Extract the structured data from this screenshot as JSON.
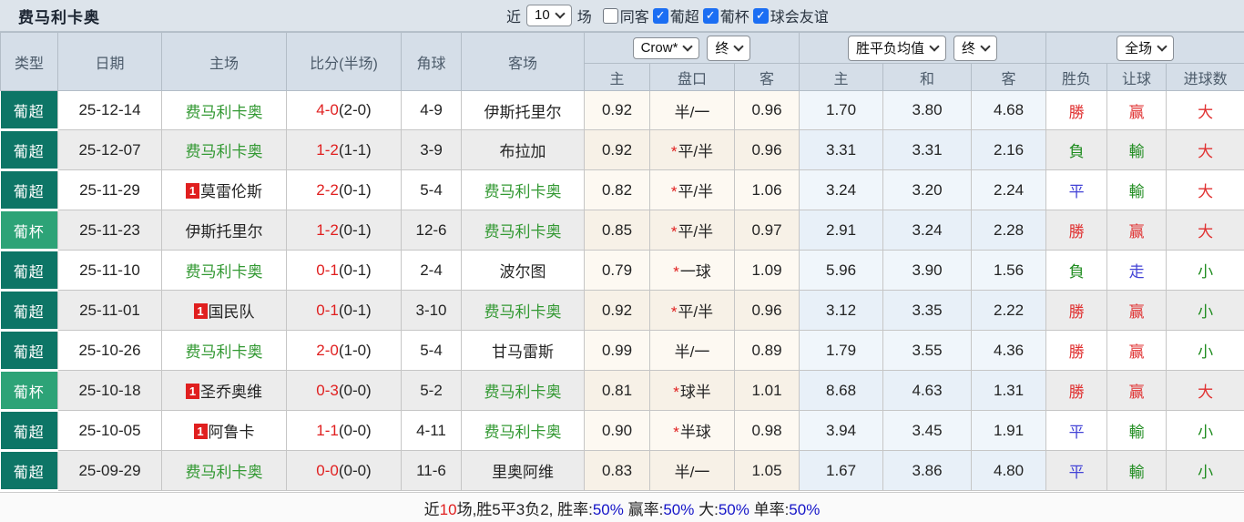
{
  "title": "费马利卡奥",
  "filters": {
    "recent_label": "近",
    "recent_value": "10",
    "recent_suffix": "场",
    "checkboxes": [
      {
        "label": "同客",
        "checked": false
      },
      {
        "label": "葡超",
        "checked": true
      },
      {
        "label": "葡杯",
        "checked": true
      },
      {
        "label": "球会友谊",
        "checked": true
      }
    ]
  },
  "table": {
    "columns": [
      "类型",
      "日期",
      "主场",
      "比分(半场)",
      "角球",
      "客场"
    ],
    "groups": [
      {
        "selects": [
          "Crow*",
          "终"
        ],
        "sub": [
          "主",
          "盘口",
          "客"
        ]
      },
      {
        "selects": [
          "胜平负均值",
          "终"
        ],
        "sub": [
          "主",
          "和",
          "客"
        ]
      },
      {
        "selects": [
          "全场"
        ],
        "sub": [
          "胜负",
          "让球",
          "进球数"
        ]
      }
    ],
    "rows": [
      {
        "league": "葡超",
        "date": "25-12-14",
        "home": {
          "name": "费马利卡奥",
          "self": true,
          "badge": null
        },
        "score": {
          "full": "4-0",
          "half": "(2-0)"
        },
        "corner": "4-9",
        "away": {
          "name": "伊斯托里尔",
          "self": false,
          "badge": null
        },
        "odds": [
          "0.92",
          "半/一",
          "0.96"
        ],
        "avg": [
          "1.70",
          "3.80",
          "4.68"
        ],
        "results": [
          {
            "t": "勝",
            "c": "red"
          },
          {
            "t": "赢",
            "c": "red"
          },
          {
            "t": "大",
            "c": "red"
          }
        ]
      },
      {
        "league": "葡超",
        "date": "25-12-07",
        "home": {
          "name": "费马利卡奥",
          "self": true,
          "badge": null
        },
        "score": {
          "full": "1-2",
          "half": "(1-1)"
        },
        "corner": "3-9",
        "away": {
          "name": "布拉加",
          "self": false,
          "badge": null
        },
        "odds": [
          "0.92",
          "*平/半",
          "0.96"
        ],
        "avg": [
          "3.31",
          "3.31",
          "2.16"
        ],
        "results": [
          {
            "t": "負",
            "c": "green"
          },
          {
            "t": "輸",
            "c": "green"
          },
          {
            "t": "大",
            "c": "red"
          }
        ]
      },
      {
        "league": "葡超",
        "date": "25-11-29",
        "home": {
          "name": "莫雷伦斯",
          "self": false,
          "badge": "1"
        },
        "score": {
          "full": "2-2",
          "half": "(0-1)"
        },
        "corner": "5-4",
        "away": {
          "name": "费马利卡奥",
          "self": true,
          "badge": null
        },
        "odds": [
          "0.82",
          "*平/半",
          "1.06"
        ],
        "avg": [
          "3.24",
          "3.20",
          "2.24"
        ],
        "results": [
          {
            "t": "平",
            "c": "blue"
          },
          {
            "t": "輸",
            "c": "green"
          },
          {
            "t": "大",
            "c": "red"
          }
        ]
      },
      {
        "league": "葡杯",
        "date": "25-11-23",
        "home": {
          "name": "伊斯托里尔",
          "self": false,
          "badge": null
        },
        "score": {
          "full": "1-2",
          "half": "(0-1)"
        },
        "corner": "12-6",
        "away": {
          "name": "费马利卡奥",
          "self": true,
          "badge": null
        },
        "odds": [
          "0.85",
          "*平/半",
          "0.97"
        ],
        "avg": [
          "2.91",
          "3.24",
          "2.28"
        ],
        "results": [
          {
            "t": "勝",
            "c": "red"
          },
          {
            "t": "赢",
            "c": "red"
          },
          {
            "t": "大",
            "c": "red"
          }
        ]
      },
      {
        "league": "葡超",
        "date": "25-11-10",
        "home": {
          "name": "费马利卡奥",
          "self": true,
          "badge": null
        },
        "score": {
          "full": "0-1",
          "half": "(0-1)"
        },
        "corner": "2-4",
        "away": {
          "name": "波尔图",
          "self": false,
          "badge": null
        },
        "odds": [
          "0.79",
          "*一球",
          "1.09"
        ],
        "avg": [
          "5.96",
          "3.90",
          "1.56"
        ],
        "results": [
          {
            "t": "負",
            "c": "green"
          },
          {
            "t": "走",
            "c": "blue"
          },
          {
            "t": "小",
            "c": "green"
          }
        ]
      },
      {
        "league": "葡超",
        "date": "25-11-01",
        "home": {
          "name": "国民队",
          "self": false,
          "badge": "1"
        },
        "score": {
          "full": "0-1",
          "half": "(0-1)"
        },
        "corner": "3-10",
        "away": {
          "name": "费马利卡奥",
          "self": true,
          "badge": null
        },
        "odds": [
          "0.92",
          "*平/半",
          "0.96"
        ],
        "avg": [
          "3.12",
          "3.35",
          "2.22"
        ],
        "results": [
          {
            "t": "勝",
            "c": "red"
          },
          {
            "t": "赢",
            "c": "red"
          },
          {
            "t": "小",
            "c": "green"
          }
        ]
      },
      {
        "league": "葡超",
        "date": "25-10-26",
        "home": {
          "name": "费马利卡奥",
          "self": true,
          "badge": null
        },
        "score": {
          "full": "2-0",
          "half": "(1-0)"
        },
        "corner": "5-4",
        "away": {
          "name": "甘马雷斯",
          "self": false,
          "badge": null
        },
        "odds": [
          "0.99",
          "半/一",
          "0.89"
        ],
        "avg": [
          "1.79",
          "3.55",
          "4.36"
        ],
        "results": [
          {
            "t": "勝",
            "c": "red"
          },
          {
            "t": "赢",
            "c": "red"
          },
          {
            "t": "小",
            "c": "green"
          }
        ]
      },
      {
        "league": "葡杯",
        "date": "25-10-18",
        "home": {
          "name": "圣乔奥维",
          "self": false,
          "badge": "1"
        },
        "score": {
          "full": "0-3",
          "half": "(0-0)"
        },
        "corner": "5-2",
        "away": {
          "name": "费马利卡奥",
          "self": true,
          "badge": null
        },
        "odds": [
          "0.81",
          "*球半",
          "1.01"
        ],
        "avg": [
          "8.68",
          "4.63",
          "1.31"
        ],
        "results": [
          {
            "t": "勝",
            "c": "red"
          },
          {
            "t": "赢",
            "c": "red"
          },
          {
            "t": "大",
            "c": "red"
          }
        ]
      },
      {
        "league": "葡超",
        "date": "25-10-05",
        "home": {
          "name": "阿鲁卡",
          "self": false,
          "badge": "1"
        },
        "score": {
          "full": "1-1",
          "half": "(0-0)"
        },
        "corner": "4-11",
        "away": {
          "name": "费马利卡奥",
          "self": true,
          "badge": null
        },
        "odds": [
          "0.90",
          "*半球",
          "0.98"
        ],
        "avg": [
          "3.94",
          "3.45",
          "1.91"
        ],
        "results": [
          {
            "t": "平",
            "c": "blue"
          },
          {
            "t": "輸",
            "c": "green"
          },
          {
            "t": "小",
            "c": "green"
          }
        ]
      },
      {
        "league": "葡超",
        "date": "25-09-29",
        "home": {
          "name": "费马利卡奥",
          "self": true,
          "badge": null
        },
        "score": {
          "full": "0-0",
          "half": "(0-0)"
        },
        "corner": "11-6",
        "away": {
          "name": "里奥阿维",
          "self": false,
          "badge": null
        },
        "odds": [
          "0.83",
          "半/一",
          "1.05"
        ],
        "avg": [
          "1.67",
          "3.86",
          "4.80"
        ],
        "results": [
          {
            "t": "平",
            "c": "blue"
          },
          {
            "t": "輸",
            "c": "green"
          },
          {
            "t": "小",
            "c": "green"
          }
        ]
      }
    ]
  },
  "footer": {
    "segments": [
      {
        "text": "近",
        "color": "black"
      },
      {
        "text": "10",
        "color": "red"
      },
      {
        "text": "场,胜5平3负2, 胜率:",
        "color": "black"
      },
      {
        "text": "50%",
        "color": "blue"
      },
      {
        "text": " 赢率:",
        "color": "black"
      },
      {
        "text": "50%",
        "color": "blue"
      },
      {
        "text": " 大:",
        "color": "black"
      },
      {
        "text": "50%",
        "color": "blue"
      },
      {
        "text": " 单率:",
        "color": "black"
      },
      {
        "text": "50%",
        "color": "blue"
      }
    ]
  },
  "colors": {
    "league_super": "#0d7566",
    "league_cup": "#2da377",
    "team_self_green": "#339933",
    "score_red": "#e01f1f",
    "result_red": "#e03030",
    "result_green": "#1f8c1f",
    "result_blue": "#4343d6",
    "percent_blue": "#1515c8",
    "checkbox_blue": "#1b6ef3",
    "header_bg": "#d5dee8",
    "topbar_bg": "#dde4eb"
  }
}
